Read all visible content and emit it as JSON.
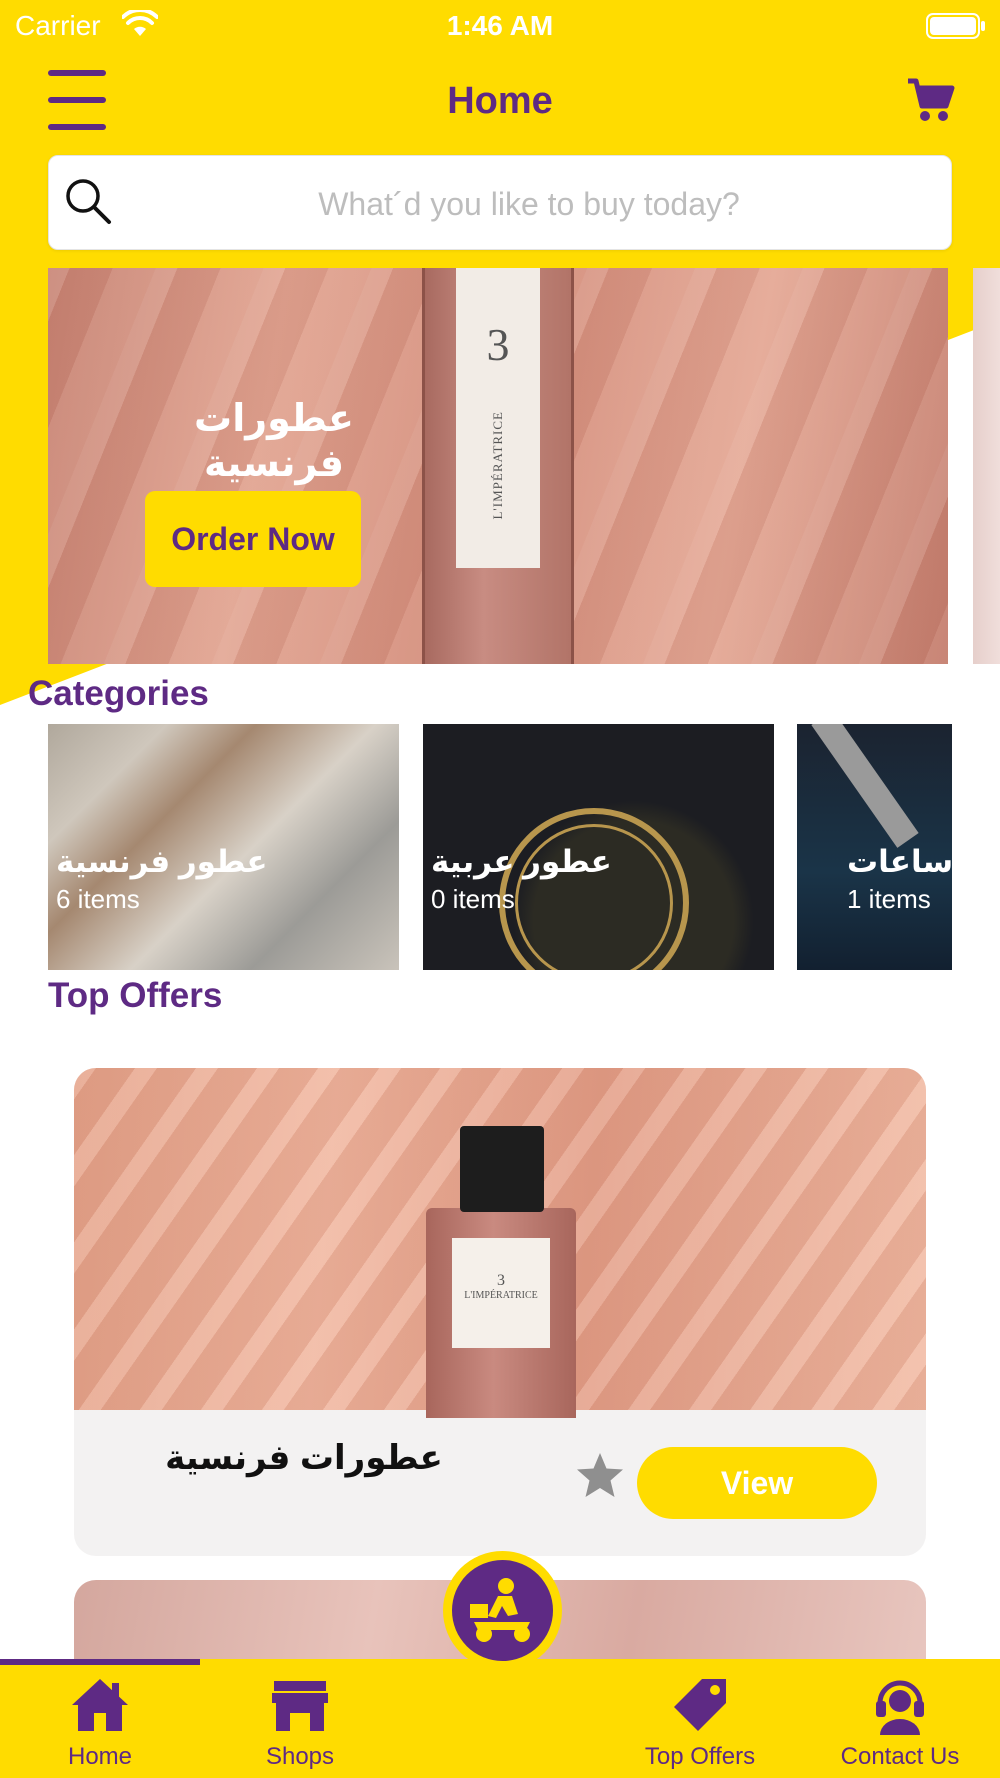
{
  "status_bar": {
    "carrier": "Carrier",
    "time": "1:46 AM"
  },
  "header": {
    "title": "Home"
  },
  "search": {
    "placeholder": "What´d you like to buy today?"
  },
  "banner": {
    "title": "عطورات فرنسية",
    "cta_label": "Order Now",
    "product_number": "3",
    "product_brand": "L'IMPÉRATRICE"
  },
  "categories": {
    "title": "Categories",
    "items": [
      {
        "name": "عطور فرنسية",
        "count": "6 items"
      },
      {
        "name": "عطور عربية",
        "count": "0 items"
      },
      {
        "name": "ساعات",
        "count": "1 items"
      }
    ]
  },
  "top_offers": {
    "title": "Top Offers",
    "items": [
      {
        "name": "عطورات فرنسية",
        "action_label": "View",
        "product_number": "3",
        "product_brand": "L'IMPÉRATRICE"
      }
    ]
  },
  "tab_bar": {
    "items": [
      {
        "label": "Home",
        "icon": "home-icon",
        "active": true
      },
      {
        "label": "Shops",
        "icon": "shop-icon",
        "active": false
      },
      {
        "label": "Top Offers",
        "icon": "tag-icon",
        "active": false
      },
      {
        "label": "Contact Us",
        "icon": "headset-icon",
        "active": false
      }
    ],
    "center_button_icon": "delivery-scooter-icon"
  },
  "colors": {
    "primary_yellow": "#FFDC00",
    "primary_purple": "#5E2A84"
  }
}
